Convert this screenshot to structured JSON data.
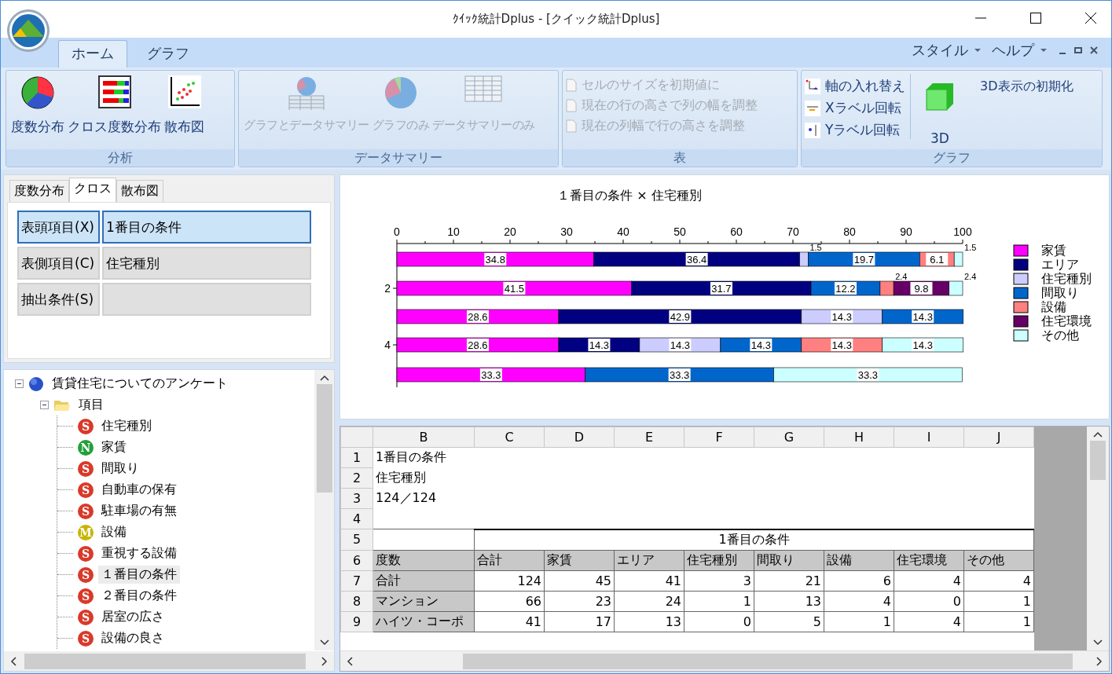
{
  "window": {
    "title": "ｸｲｯｸ統計Dplus - [クイック統計Dplus]"
  },
  "ribbon": {
    "tabs": [
      {
        "label": "ホーム",
        "selected": true
      },
      {
        "label": "グラフ",
        "selected": false
      }
    ],
    "menus": [
      {
        "label": "スタイル"
      },
      {
        "label": "ヘルプ"
      }
    ],
    "groups": [
      {
        "label": "分析",
        "kind": "large",
        "disabled": false,
        "buttons": [
          {
            "label": "度数分布"
          },
          {
            "label": "クロス度数分布"
          },
          {
            "label": "散布図"
          }
        ]
      },
      {
        "label": "データサマリー",
        "kind": "large",
        "disabled": true,
        "buttons": [
          {
            "label": "グラフとデータサマリー"
          },
          {
            "label": "グラフのみ"
          },
          {
            "label": "データサマリーのみ"
          }
        ]
      },
      {
        "label": "表",
        "kind": "small",
        "disabled": true,
        "buttons": [
          {
            "label": "セルのサイズを初期値に"
          },
          {
            "label": "現在の行の高さで列の幅を調整"
          },
          {
            "label": "現在の列幅で行の高さを調整"
          }
        ]
      },
      {
        "label": "グラフ",
        "kind": "mixed",
        "disabled": false,
        "buttons": [
          {
            "label": "軸の入れ替え",
            "kind": "small"
          },
          {
            "label": "Xラベル回転",
            "kind": "small"
          },
          {
            "label": "Yラベル回転",
            "kind": "small"
          },
          {
            "label": "3D",
            "kind": "large"
          },
          {
            "label": "3D表示の初期化",
            "kind": "text"
          }
        ]
      }
    ]
  },
  "analysis_tabs": [
    {
      "label": "度数分布",
      "selected": false
    },
    {
      "label": "クロス",
      "selected": true
    },
    {
      "label": "散布図",
      "selected": false
    }
  ],
  "settings": [
    {
      "label": "表頭項目(X)",
      "value": "1番目の条件",
      "selected": true
    },
    {
      "label": "表側項目(C)",
      "value": "住宅種別",
      "selected": false
    },
    {
      "label": "抽出条件(S)",
      "selected": false
    }
  ],
  "tree": {
    "label": "賃貸住宅についてのアンケート",
    "expanded": true,
    "children": [
      {
        "label": "項目",
        "expanded": true,
        "children": [
          {
            "label": "住宅種別",
            "badge": "S",
            "color": "#d83a2a",
            "selected": false
          },
          {
            "label": "家賃",
            "badge": "N",
            "color": "#22a03a",
            "selected": false
          },
          {
            "label": "間取り",
            "badge": "S",
            "color": "#d83a2a",
            "selected": false
          },
          {
            "label": "自動車の保有",
            "badge": "S",
            "color": "#d83a2a",
            "selected": false
          },
          {
            "label": "駐車場の有無",
            "badge": "S",
            "color": "#d83a2a",
            "selected": false
          },
          {
            "label": "設備",
            "badge": "M",
            "color": "#c8b400",
            "selected": false
          },
          {
            "label": "重視する設備",
            "badge": "S",
            "color": "#d83a2a",
            "selected": false
          },
          {
            "label": "１番目の条件",
            "badge": "S",
            "color": "#d83a2a",
            "selected": true
          },
          {
            "label": "２番目の条件",
            "badge": "S",
            "color": "#d83a2a",
            "selected": false
          },
          {
            "label": "居室の広さ",
            "badge": "S",
            "color": "#d83a2a",
            "selected": false
          },
          {
            "label": "設備の良さ",
            "badge": "S",
            "color": "#d83a2a",
            "selected": false
          }
        ]
      }
    ]
  },
  "chart": {
    "chart_data": {
      "type": "bar",
      "orientation": "horizontal",
      "stacked": true,
      "title": "１番目の条件 × 住宅種別",
      "xlim": [
        0,
        100
      ],
      "xticks": [
        0,
        10,
        20,
        30,
        40,
        50,
        60,
        70,
        80,
        90,
        100
      ],
      "categories": [
        null,
        "2",
        null,
        "4",
        null
      ],
      "legend": "right",
      "data_labels": true,
      "series": [
        {
          "name": "家賃",
          "color": "#ff00ff",
          "values": [
            34.8,
            41.5,
            28.6,
            28.6,
            33.3
          ]
        },
        {
          "name": "エリア",
          "color": "#000080",
          "values": [
            36.4,
            31.7,
            42.9,
            14.3,
            null
          ]
        },
        {
          "name": "住宅種別",
          "color": "#ccccff",
          "values": [
            1.5,
            null,
            14.3,
            14.3,
            null
          ]
        },
        {
          "name": "間取り",
          "color": "#0066cc",
          "values": [
            19.7,
            12.2,
            14.3,
            14.3,
            33.3
          ]
        },
        {
          "name": "設備",
          "color": "#ff8080",
          "values": [
            6.1,
            2.4,
            null,
            14.3,
            null
          ]
        },
        {
          "name": "住宅環境",
          "color": "#660066",
          "values": [
            null,
            9.8,
            null,
            null,
            null
          ]
        },
        {
          "name": "その他",
          "color": "#ccffff",
          "values": [
            1.5,
            2.4,
            null,
            14.3,
            33.3
          ]
        }
      ]
    }
  },
  "sheet": {
    "columns": [
      "B",
      "C",
      "D",
      "E",
      "F",
      "G",
      "H",
      "I",
      "J"
    ],
    "rows": [
      {
        "num": "1",
        "kind": "note",
        "text": "1番目の条件"
      },
      {
        "num": "2",
        "kind": "note",
        "text": "住宅種別"
      },
      {
        "num": "3",
        "kind": "note",
        "text": "124／124"
      },
      {
        "num": "4",
        "kind": "note"
      },
      {
        "num": "5",
        "kind": "title",
        "title": "1番目の条件"
      },
      {
        "num": "6",
        "kind": "header",
        "cells": [
          "度数",
          "合計",
          "家賃",
          "エリア",
          "住宅種別",
          "間取り",
          "設備",
          "住宅環境",
          "その他"
        ]
      },
      {
        "num": "7",
        "kind": "data",
        "cells": [
          "合計",
          "124",
          "45",
          "41",
          "3",
          "21",
          "6",
          "4",
          "4"
        ]
      },
      {
        "num": "8",
        "kind": "data",
        "cells": [
          "マンション",
          "66",
          "23",
          "24",
          "1",
          "13",
          "4",
          "0",
          "1"
        ]
      },
      {
        "num": "9",
        "kind": "data",
        "cells": [
          "ハイツ・コーポ",
          "41",
          "17",
          "13",
          "0",
          "5",
          "1",
          "4",
          "1"
        ]
      }
    ]
  }
}
